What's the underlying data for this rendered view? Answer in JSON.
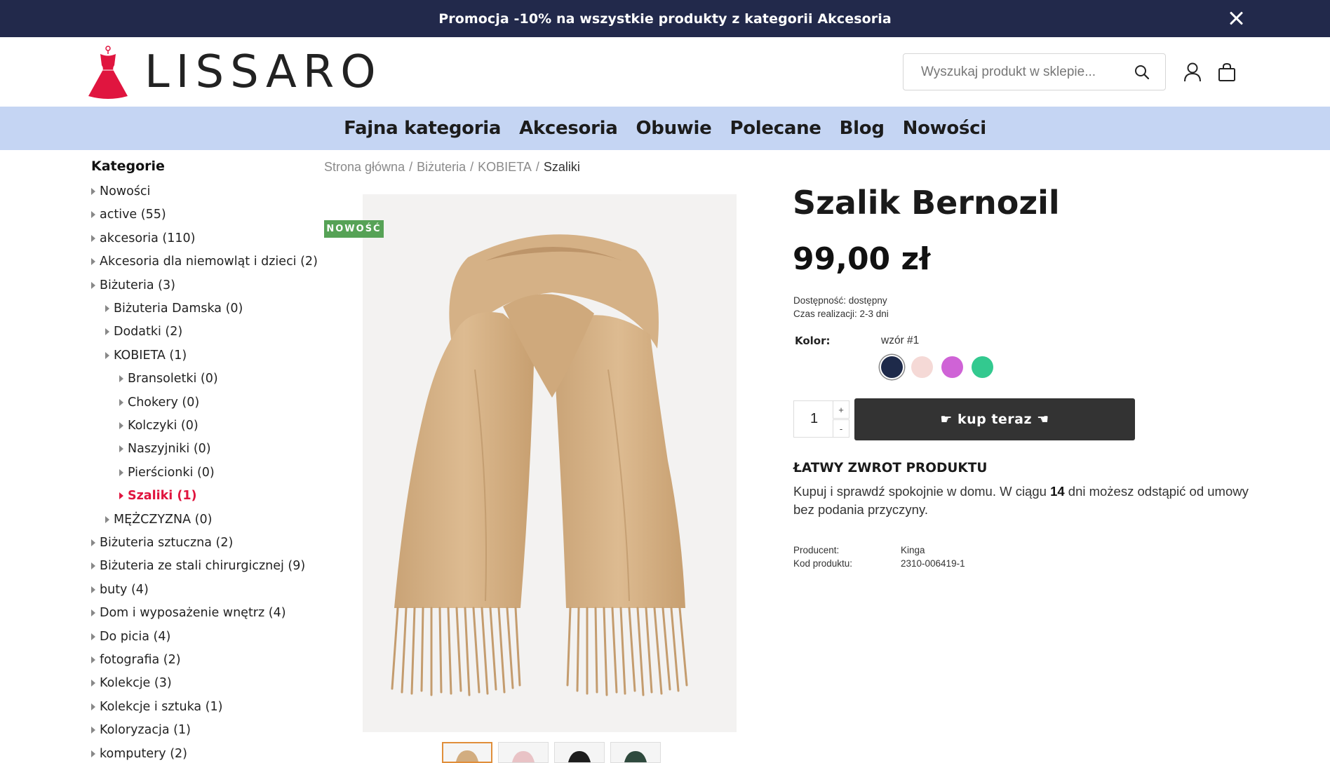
{
  "promo": {
    "text": "Promocja -10% na wszystkie produkty z kategorii Akcesoria",
    "close_icon": "close-icon"
  },
  "header": {
    "logo_text": "LISSARO",
    "logo_icon": "dress-icon",
    "brand_color": "#e0153f",
    "search_placeholder": "Wyszukaj produkt w sklepie...",
    "icons": [
      "search-icon",
      "user-icon",
      "cart-icon"
    ]
  },
  "nav": {
    "items": [
      "Fajna kategoria",
      "Akcesoria",
      "Obuwie",
      "Polecane",
      "Blog",
      "Nowości"
    ],
    "background": "#c5d5f3"
  },
  "sidebar": {
    "title": "Kategorie",
    "items": [
      {
        "label": "Nowości",
        "level": 0
      },
      {
        "label": "active (55)",
        "level": 0
      },
      {
        "label": "akcesoria (110)",
        "level": 0
      },
      {
        "label": "Akcesoria dla niemowląt i dzieci (2)",
        "level": 0
      },
      {
        "label": "Biżuteria (3)",
        "level": 0
      },
      {
        "label": "Biżuteria Damska (0)",
        "level": 1
      },
      {
        "label": "Dodatki (2)",
        "level": 1
      },
      {
        "label": "KOBIETA (1)",
        "level": 1
      },
      {
        "label": "Bransoletki (0)",
        "level": 2
      },
      {
        "label": "Chokery (0)",
        "level": 2
      },
      {
        "label": "Kolczyki (0)",
        "level": 2
      },
      {
        "label": "Naszyjniki (0)",
        "level": 2
      },
      {
        "label": "Pierścionki (0)",
        "level": 2
      },
      {
        "label": "Szaliki (1)",
        "level": 2,
        "active": true
      },
      {
        "label": "MĘŻCZYZNA (0)",
        "level": 1
      },
      {
        "label": "Biżuteria sztuczna (2)",
        "level": 0
      },
      {
        "label": "Biżuteria ze stali chirurgicznej (9)",
        "level": 0
      },
      {
        "label": "buty (4)",
        "level": 0
      },
      {
        "label": "Dom i wyposażenie wnętrz (4)",
        "level": 0
      },
      {
        "label": "Do picia (4)",
        "level": 0
      },
      {
        "label": "fotografia (2)",
        "level": 0
      },
      {
        "label": "Kolekcje (3)",
        "level": 0
      },
      {
        "label": "Kolekcje i sztuka (1)",
        "level": 0
      },
      {
        "label": "Koloryzacja (1)",
        "level": 0
      },
      {
        "label": "komputery (2)",
        "level": 0
      }
    ]
  },
  "breadcrumb": {
    "items": [
      "Strona główna",
      "Biżuteria",
      "KOBIETA"
    ],
    "current": "Szaliki"
  },
  "product": {
    "badge": "NOWOŚĆ",
    "badge_color": "#56a256",
    "title": "Szalik Bernozil",
    "price": "99,00 zł",
    "availability": "Dostępność: dostępny",
    "lead_time": "Czas realizacji: 2-3 dni",
    "color_label": "Kolor:",
    "color_value": "wzór #1",
    "swatches": [
      {
        "name": "wzór #1",
        "color": "#1e2a4a",
        "selected": true
      },
      {
        "name": "wzór #2",
        "color": "#f5d9d6"
      },
      {
        "name": "wzór #3",
        "color": "#cf63d6"
      },
      {
        "name": "wzór #4",
        "color": "#33c98f"
      }
    ],
    "quantity": "1",
    "qty_plus": "+",
    "qty_minus": "-",
    "buy_label": "☛ kup teraz ☚",
    "return_title": "ŁATWY ZWROT PRODUKTU",
    "return_text_before": "Kupuj i sprawdź spokojnie w domu. W ciągu ",
    "return_days": "14",
    "return_text_after": " dni możesz odstąpić od umowy bez podania przyczyny.",
    "specs": [
      {
        "key": "Producent:",
        "value": "Kinga"
      },
      {
        "key": "Kod produktu:",
        "value": "2310-006419-1"
      }
    ],
    "thumbnails": [
      "scarf-beige",
      "scarf-pink",
      "scarf-black",
      "scarf-green"
    ]
  }
}
